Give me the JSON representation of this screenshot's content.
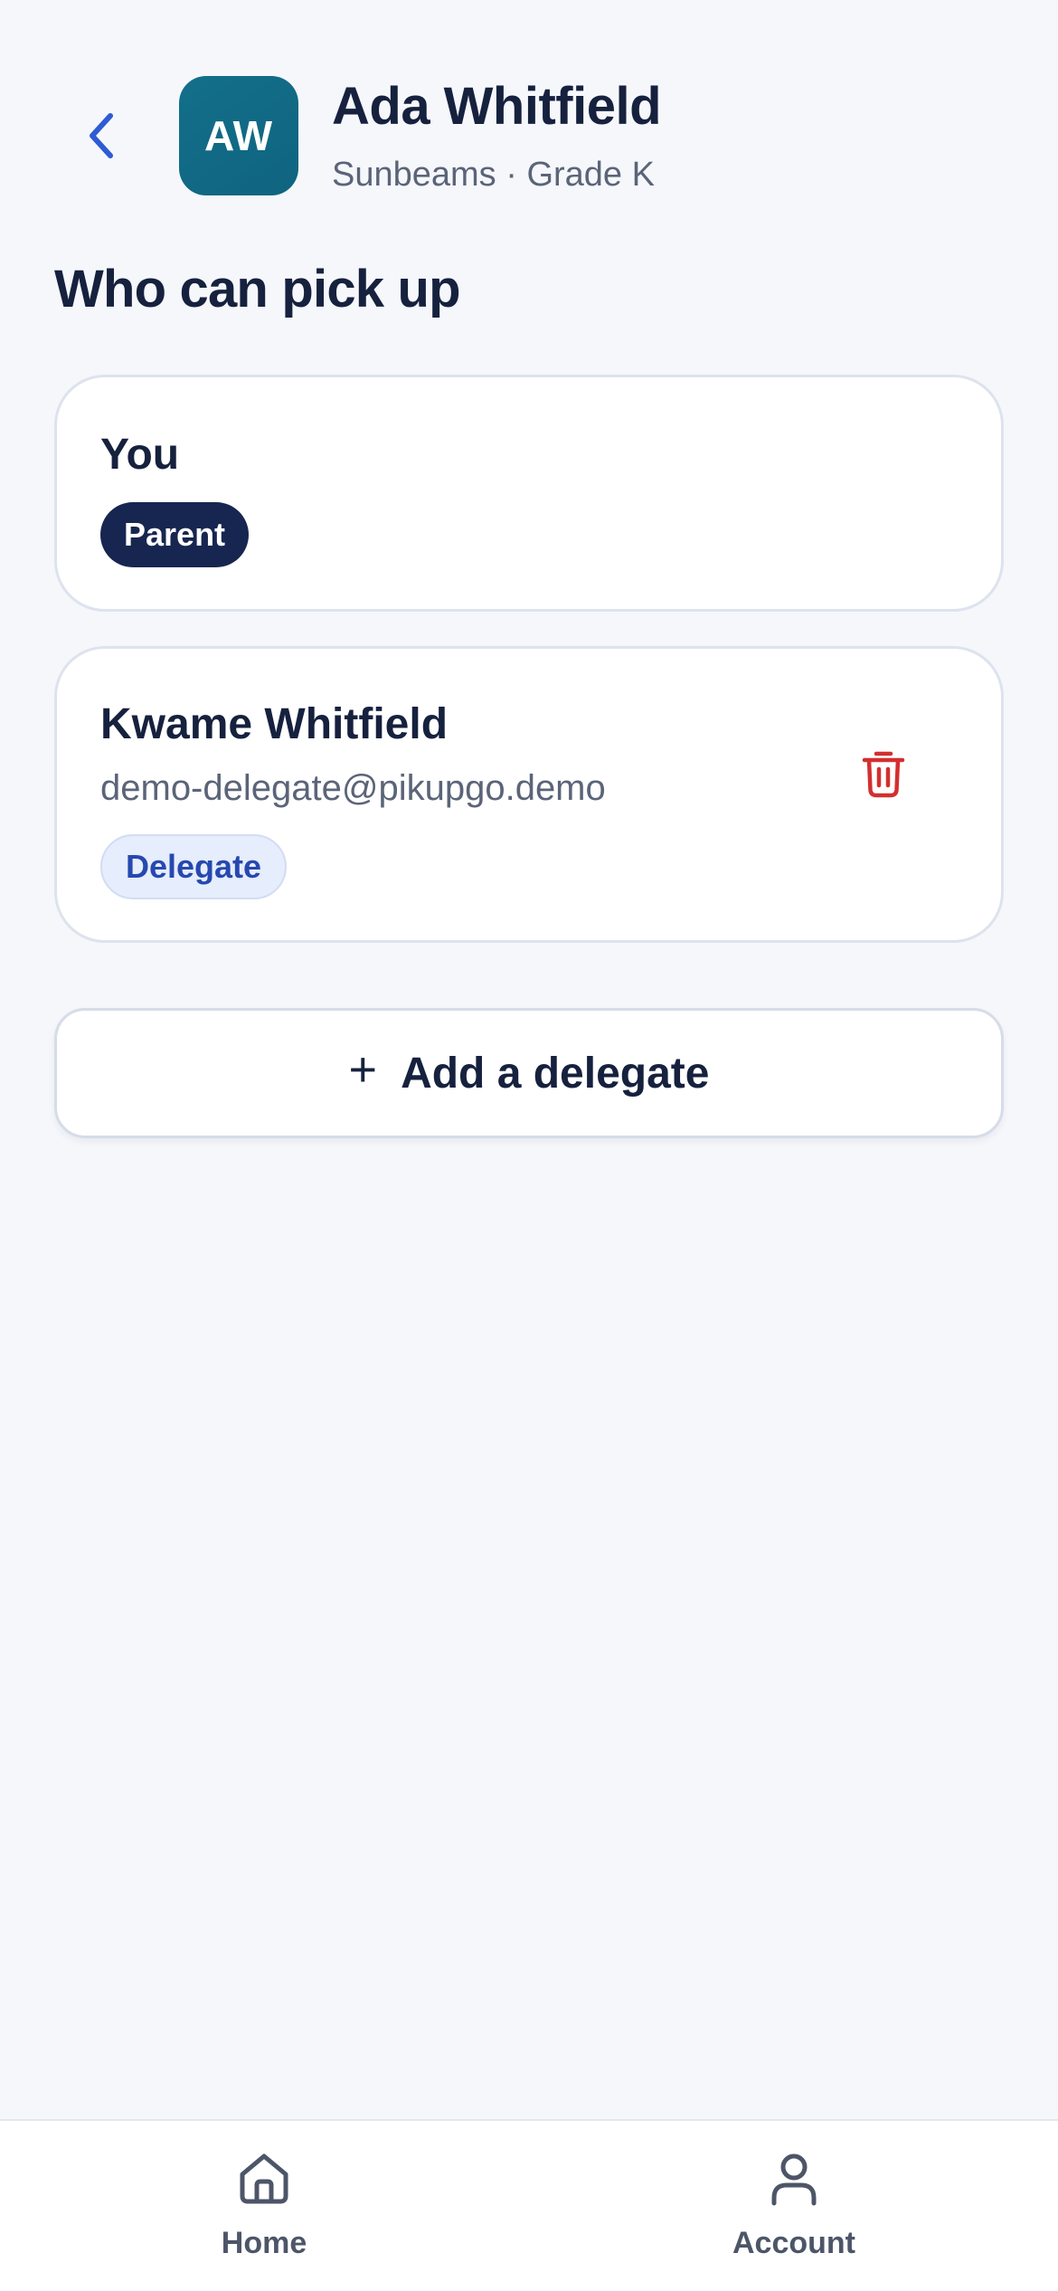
{
  "header": {
    "back_icon": "chevron-left-icon",
    "avatar_initials": "AW",
    "avatar_color": "#136f8a",
    "child_name": "Ada Whitfield",
    "child_subtitle": "Sunbeams · Grade K"
  },
  "section": {
    "title": "Who can pick up"
  },
  "pickup_people": [
    {
      "name": "You",
      "role": "Parent"
    },
    {
      "name": "Kwame Whitfield",
      "email": "demo-delegate@pikupgo.demo",
      "role": "Delegate",
      "delete_icon": "trash-icon"
    }
  ],
  "actions": {
    "add_delegate_label": "Add a delegate",
    "add_icon": "plus-icon"
  },
  "bottom_nav": [
    {
      "label": "Home",
      "icon": "home-icon"
    },
    {
      "label": "Account",
      "icon": "user-icon"
    }
  ],
  "colors": {
    "background": "#f5f7fb",
    "primary_text": "#16213e",
    "accent_blue": "#2f5bd3",
    "parent_badge": "#172650",
    "delegate_badge_bg": "#e6edfc",
    "delegate_badge_text": "#2748b0",
    "danger": "#d32f2f"
  }
}
